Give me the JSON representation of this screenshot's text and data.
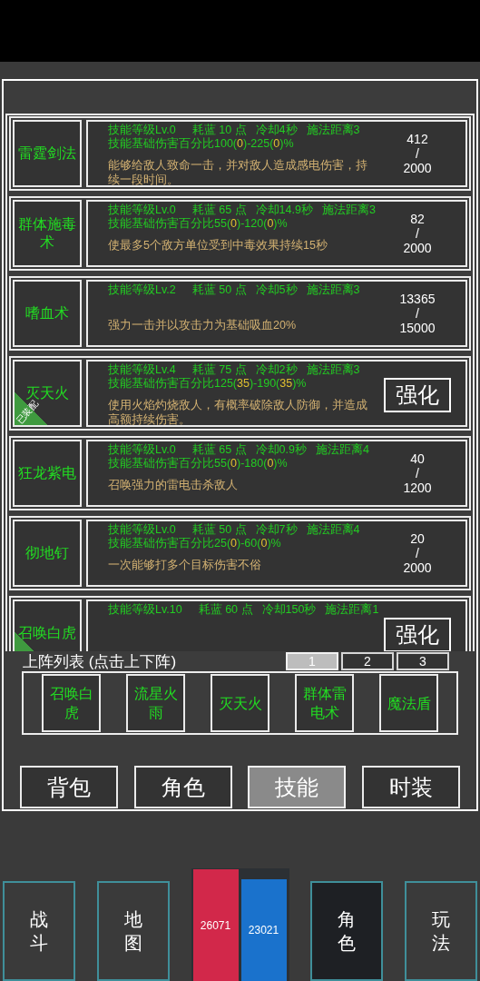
{
  "skills": [
    {
      "name": "雷霆剑法",
      "equipped": false,
      "stats": [
        "技能等级Lv.0",
        "耗蓝 10 点",
        "冷却4秒",
        "施法距离3"
      ],
      "damage": "技能基础伤害百分比100(**0**)-225(**0**)%",
      "description": "能够给敌人致命一击，并对敌人造成感电伤害，持续一段时间。",
      "kind": "progress",
      "progress": [
        "412",
        "/",
        "2000"
      ]
    },
    {
      "name": "群体施毒术",
      "equipped": false,
      "stats": [
        "技能等级Lv.0",
        "耗蓝 65 点",
        "冷却14.9秒",
        "施法距离3"
      ],
      "damage": "技能基础伤害百分比55(**0**)-120(**0**)%",
      "description": "使最多5个敌方单位受到中毒效果持续15秒",
      "kind": "progress",
      "progress": [
        "82",
        "/",
        "2000"
      ]
    },
    {
      "name": "嗜血术",
      "equipped": false,
      "stats": [
        "技能等级Lv.2",
        "耗蓝 50 点",
        "冷却5秒",
        "施法距离3"
      ],
      "description": "强力一击并以攻击力为基础吸血20%",
      "kind": "progress",
      "progress": [
        "13365",
        "/",
        "15000"
      ]
    },
    {
      "name": "灭天火",
      "equipped": true,
      "badge": "已装配",
      "stats": [
        "技能等级Lv.4",
        "耗蓝 75 点",
        "冷却2秒",
        "施法距离3"
      ],
      "damage": "技能基础伤害百分比125(**35**)-190(**35**)%",
      "description": "使用火焰灼烧敌人，有概率破除敌人防御，并造成高额持续伤害。",
      "kind": "upgrade",
      "button": "强化"
    },
    {
      "name": "狂龙紫电",
      "equipped": false,
      "stats": [
        "技能等级Lv.0",
        "耗蓝 65 点",
        "冷却0.9秒",
        "施法距离4"
      ],
      "damage": "技能基础伤害百分比55(**0**)-180(**0**)%",
      "description": "召唤强力的雷电击杀敌人",
      "kind": "progress",
      "progress": [
        "40",
        "/",
        "1200"
      ]
    },
    {
      "name": "彻地钉",
      "equipped": false,
      "stats": [
        "技能等级Lv.0",
        "耗蓝 50 点",
        "冷却7秒",
        "施法距离4"
      ],
      "damage": "技能基础伤害百分比25(**0**)-60(**0**)%",
      "description": "一次能够打多个目标伤害不俗",
      "kind": "progress",
      "progress": [
        "20",
        "/",
        "2000"
      ]
    },
    {
      "name": "召唤白虎",
      "equipped": true,
      "stats": [
        "技能等级Lv.10",
        "耗蓝 60 点",
        "冷却150秒",
        "施法距离1"
      ],
      "kind": "upgrade",
      "button": "强化"
    }
  ],
  "formation": {
    "title": "上阵列表 (点击上下阵)",
    "tabs": [
      {
        "label": "1",
        "selected": true
      },
      {
        "label": "2",
        "selected": false
      },
      {
        "label": "3",
        "selected": false
      }
    ],
    "slots": [
      "召唤白虎",
      "流星火雨",
      "灭天火",
      "群体雷电术",
      "魔法盾"
    ]
  },
  "menu_tabs": [
    {
      "label": "背包",
      "selected": false
    },
    {
      "label": "角色",
      "selected": false
    },
    {
      "label": "技能",
      "selected": true
    },
    {
      "label": "时装",
      "selected": false
    }
  ],
  "bottom_nav": [
    {
      "kind": "button",
      "label": "战斗",
      "selected": false
    },
    {
      "kind": "button",
      "label": "地图",
      "selected": false
    },
    {
      "kind": "stats",
      "values": [
        {
          "value": "26071",
          "color": "#d2284a"
        },
        {
          "value": "23021",
          "color": "#1a72cc"
        }
      ]
    },
    {
      "kind": "button",
      "label": "角色",
      "selected": true
    },
    {
      "kind": "button",
      "label": "玩法",
      "selected": false
    }
  ]
}
